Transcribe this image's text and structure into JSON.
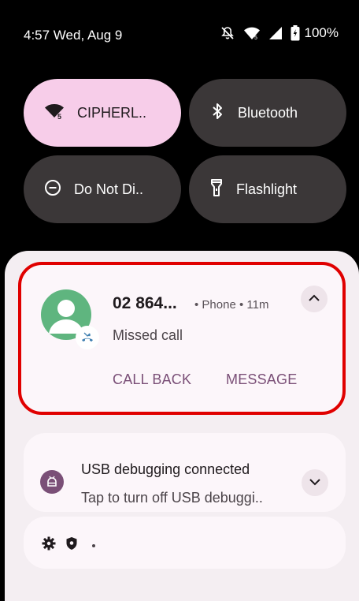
{
  "status_bar": {
    "time": "4:57 Wed, Aug 9",
    "battery": "100%",
    "icons": [
      "notifications-muted-icon",
      "wifi-icon",
      "cell-signal-icon",
      "battery-charging-icon"
    ]
  },
  "quick_settings": {
    "tiles": [
      {
        "label": "CIPHERL..",
        "icon": "wifi-icon",
        "active": true
      },
      {
        "label": "Bluetooth",
        "icon": "bluetooth-icon",
        "active": false
      },
      {
        "label": "Do Not Di..",
        "icon": "do-not-disturb-icon",
        "active": false
      },
      {
        "label": "Flashlight",
        "icon": "flashlight-icon",
        "active": false
      }
    ]
  },
  "notifications": {
    "call": {
      "title": "02 864...",
      "meta": "• Phone • 11m",
      "body": "Missed call",
      "actions": [
        "CALL BACK",
        "MESSAGE"
      ],
      "icon": "missed-call-icon"
    },
    "usb": {
      "title": "USB debugging connected",
      "body": "Tap to turn off USB debuggi..",
      "icon": "usb-debug-icon"
    },
    "mini": {
      "icons": [
        "settings-icon",
        "shield-icon"
      ]
    }
  },
  "colors": {
    "active_tile": "#f7cde9",
    "inactive_tile": "#3b3738",
    "accent": "#7a4f77",
    "highlight": "#e00000",
    "avatar": "#5fb57f"
  }
}
